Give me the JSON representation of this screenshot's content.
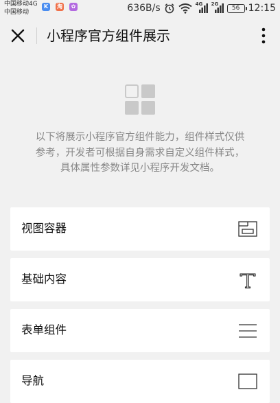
{
  "status_bar": {
    "carrier_line1": "中国移动4G",
    "carrier_line2": "中国移动",
    "apps": [
      {
        "icon": "k-app-icon",
        "glyph": "K",
        "color": "#4a8df0"
      },
      {
        "icon": "taobao-app-icon",
        "glyph": "淘",
        "color": "#f0714a"
      },
      {
        "icon": "purple-app-icon",
        "glyph": "✿",
        "color": "#b36ae0"
      }
    ],
    "net_speed": "636B/s",
    "signal1_label": "4G",
    "signal2_label": "2G",
    "battery_level": "56",
    "time": "12:15"
  },
  "nav": {
    "title": "小程序官方组件展示"
  },
  "intro": {
    "line1": "以下将展示小程序官方组件能力，组件样式仅供",
    "line2": "参考，开发者可根据自身需求自定义组件样式，",
    "line3": "具体属性参数详见小程序开发文档。"
  },
  "menu": {
    "items": [
      {
        "label": "视图容器",
        "icon": "view-container-icon"
      },
      {
        "label": "基础内容",
        "icon": "text-t-icon"
      },
      {
        "label": "表单组件",
        "icon": "form-lines-icon"
      },
      {
        "label": "导航",
        "icon": "navigation-icon"
      }
    ]
  },
  "colors": {
    "background": "#f1f1f1",
    "card": "#ffffff",
    "logo": "#c9c9c9",
    "intro_text": "#888888"
  }
}
